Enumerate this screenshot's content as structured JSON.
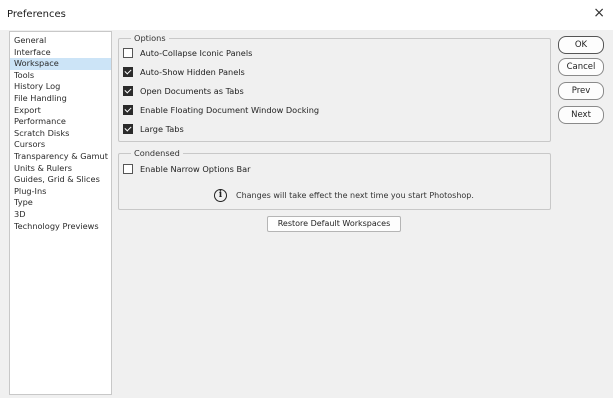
{
  "window": {
    "title": "Preferences",
    "close_glyph": "×"
  },
  "sidebar": {
    "items": [
      {
        "label": "General",
        "selected": false
      },
      {
        "label": "Interface",
        "selected": false
      },
      {
        "label": "Workspace",
        "selected": true
      },
      {
        "label": "Tools",
        "selected": false
      },
      {
        "label": "History Log",
        "selected": false
      },
      {
        "label": "File Handling",
        "selected": false
      },
      {
        "label": "Export",
        "selected": false
      },
      {
        "label": "Performance",
        "selected": false
      },
      {
        "label": "Scratch Disks",
        "selected": false
      },
      {
        "label": "Cursors",
        "selected": false
      },
      {
        "label": "Transparency & Gamut",
        "selected": false
      },
      {
        "label": "Units & Rulers",
        "selected": false
      },
      {
        "label": "Guides, Grid & Slices",
        "selected": false
      },
      {
        "label": "Plug-Ins",
        "selected": false
      },
      {
        "label": "Type",
        "selected": false
      },
      {
        "label": "3D",
        "selected": false
      },
      {
        "label": "Technology Previews",
        "selected": false
      }
    ]
  },
  "options": {
    "label": "Options",
    "items": [
      {
        "label": "Auto-Collapse Iconic Panels",
        "checked": false
      },
      {
        "label": "Auto-Show Hidden Panels",
        "checked": true
      },
      {
        "label": "Open Documents as Tabs",
        "checked": true
      },
      {
        "label": "Enable Floating Document Window Docking",
        "checked": true
      },
      {
        "label": "Large Tabs",
        "checked": true
      }
    ]
  },
  "condensed": {
    "label": "Condensed",
    "narrow_options_bar": {
      "label": "Enable Narrow Options Bar",
      "checked": false
    },
    "info_icon": "info-icon",
    "info_text": "Changes will take effect the next time you start Photoshop."
  },
  "restore_button": "Restore Default Workspaces",
  "buttons": {
    "ok": "OK",
    "cancel": "Cancel",
    "prev": "Prev",
    "next": "Next"
  }
}
